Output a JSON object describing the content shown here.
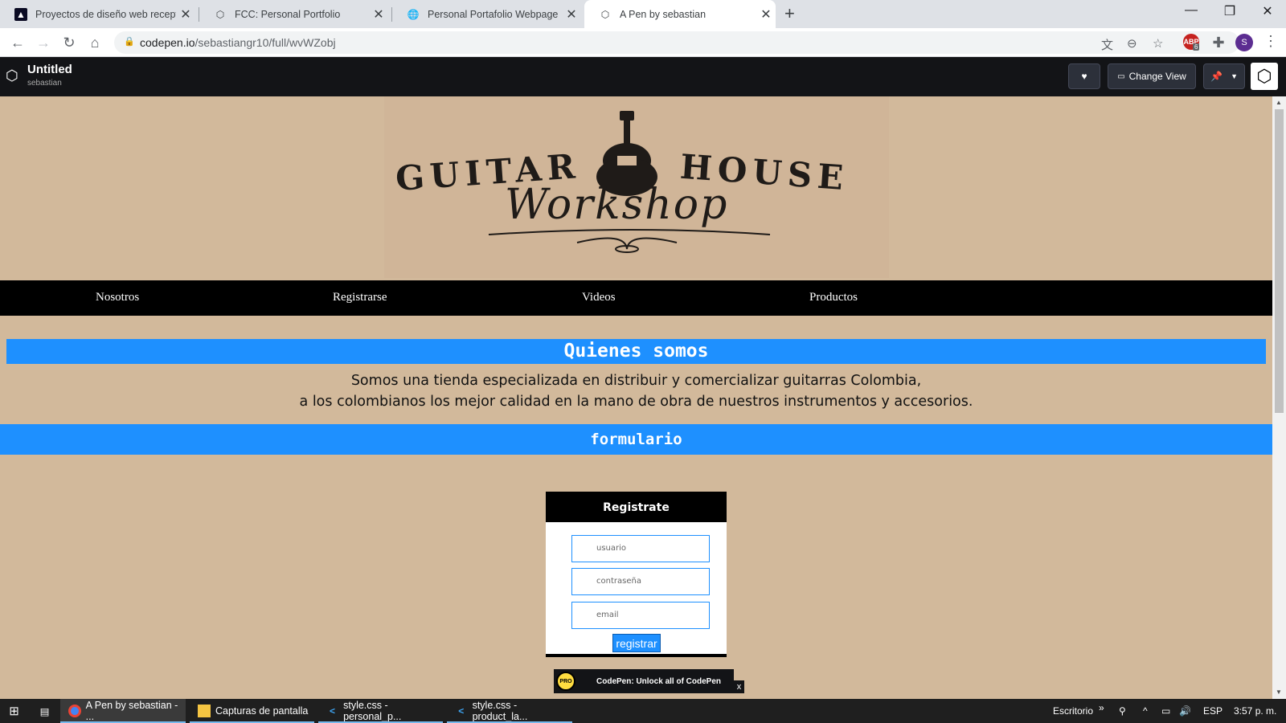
{
  "browser": {
    "tabs": [
      {
        "title": "Proyectos de diseño web recepti",
        "icon": "fcc-icon"
      },
      {
        "title": "FCC: Personal Portfolio",
        "icon": "codepen-icon"
      },
      {
        "title": "Personal Portafolio Webpage",
        "icon": "globe-icon"
      },
      {
        "title": "A Pen by sebastian",
        "icon": "codepen-icon",
        "active": true
      }
    ],
    "url_host": "codepen.io",
    "url_path": "/sebastiangr10/full/wvWZobj",
    "profile_initial": "S",
    "extension_badge": "6"
  },
  "codepen": {
    "title": "Untitled",
    "user": "sebastian",
    "change_view_label": "Change View"
  },
  "site": {
    "logo_left": "GUITAR",
    "logo_right": "HOUSE",
    "logo_script": "Workshop",
    "nav": [
      "Nosotros",
      "Registrarse",
      "Videos",
      "Productos"
    ],
    "about_heading": "Quienes somos",
    "about_line1": "Somos una tienda especializada en distribuir y comercializar guitarras Colombia,",
    "about_line2": "a los colombianos los mejor calidad en la mano de obra de nuestros instrumentos y accesorios.",
    "form_heading": "formulario",
    "form": {
      "title": "Registrate",
      "fields": [
        "usuario",
        "contraseña",
        "email"
      ],
      "submit": "registrar"
    },
    "promo_badge": "PRO",
    "promo_text": "CodePen: Unlock all of CodePen",
    "promo_close": "x"
  },
  "taskbar": {
    "items": [
      {
        "label": "A Pen by sebastian - ...",
        "icon": "chrome-icon",
        "active": true
      },
      {
        "label": "Capturas de pantalla",
        "icon": "folder-icon"
      },
      {
        "label": "style.css - personal_p...",
        "icon": "vscode-icon"
      },
      {
        "label": "style.css - product_la...",
        "icon": "vscode-icon"
      }
    ],
    "desktop_label": "Escritorio",
    "lang": "ESP",
    "time": "3:57 p. m."
  },
  "colors": {
    "page_bg": "#d2b99b",
    "accent_blue": "#1e90ff",
    "nav_bg": "#000000",
    "codepen_bar": "#131417"
  }
}
